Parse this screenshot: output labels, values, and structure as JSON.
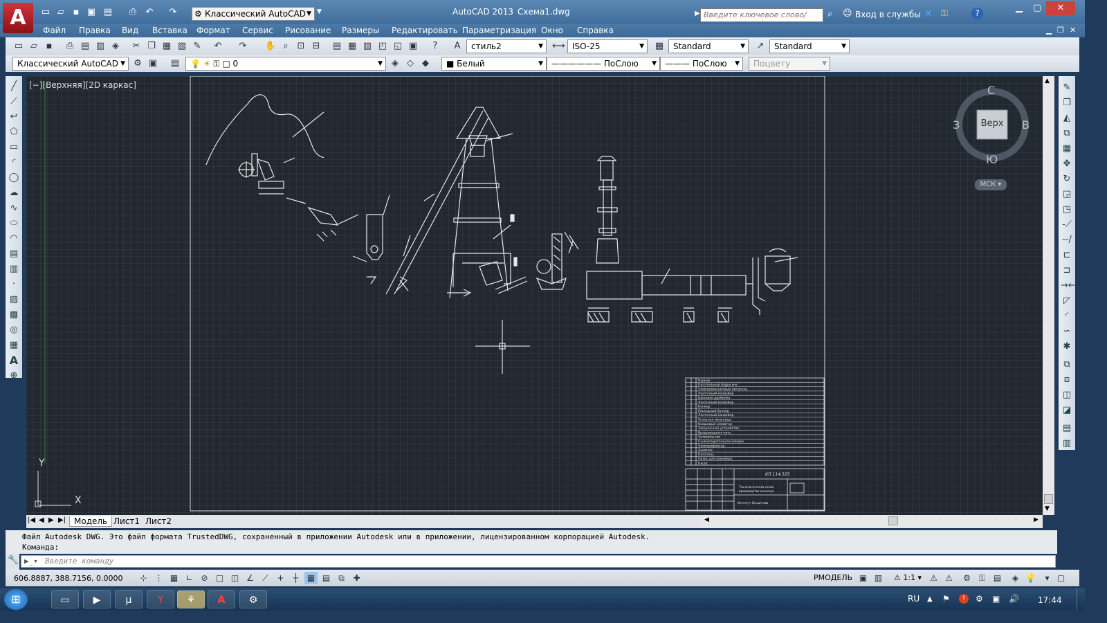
{
  "window": {
    "app_title": "AutoCAD 2013",
    "doc_title": "Схема1.dwg",
    "workspace": "Классический AutoCAD",
    "search_placeholder": "Введите ключевое слово/фразу",
    "signin_label": "Вход в службы"
  },
  "menu": [
    "Файл",
    "Правка",
    "Вид",
    "Вставка",
    "Формат",
    "Сервис",
    "Рисование",
    "Размеры",
    "Редактировать",
    "Параметризация",
    "Окно",
    "Справка"
  ],
  "styles_toolbar": {
    "text_style": "стиль2",
    "dim_style": "ISO-25",
    "table_style": "Standard",
    "mleader_style": "Standard"
  },
  "layers_toolbar": {
    "workspace": "Классический AutoCAD",
    "layer": "0",
    "color": "Белый",
    "linetype": "ПоСлою",
    "lineweight": "ПоСлою",
    "plotstyle": "Поцвету"
  },
  "viewport": {
    "label": "[−][Верхняя][2D каркас]"
  },
  "viewcube": {
    "top_face": "Верх",
    "north": "С",
    "south": "Ю",
    "east": "В",
    "west": "З",
    "ucs": "МСК"
  },
  "ucs_axes": {
    "x": "X",
    "y": "Y"
  },
  "tabs": [
    "Модель",
    "Лист1",
    "Лист2"
  ],
  "command": {
    "history_line1": "Файл Autodesk DWG. Это файл формата TrustedDWG, сохраненный в приложении Autodesk или в приложении, лицензированном корпорацией Autodesk.",
    "history_line2": "Команда:",
    "input_placeholder": "Введите команду"
  },
  "status": {
    "coords": "606.8887, 388.7156, 0.0000",
    "space": "РМОДЕЛЬ",
    "scale": "1:1"
  },
  "drawing": {
    "spec_rows": [
      "Карьер",
      "Питательная бадья мчс",
      "Электромагнитный питатель",
      "Ленточный конвейер",
      "Щековая дробилка",
      "Ленточный конвейер",
      "Бункер",
      "Расходный бункер",
      "Ленточный конвейер",
      "Угольная мельница",
      "Ковшовый элеватор",
      "Загрузочное устройство",
      "Вращающаяся печь",
      "Холодильник",
      "Пылеосадительная камера",
      "Электрофильтр",
      "Дымосос",
      "Питатель",
      "Силос для клинкера",
      "Насос"
    ],
    "stamp_code": "КП 114.525",
    "stamp_lines": [
      "Технологическая схема",
      "производства клинкера",
      "Институт Бесщетова"
    ]
  },
  "taskbar": {
    "lang": "RU",
    "time": "17:44"
  }
}
